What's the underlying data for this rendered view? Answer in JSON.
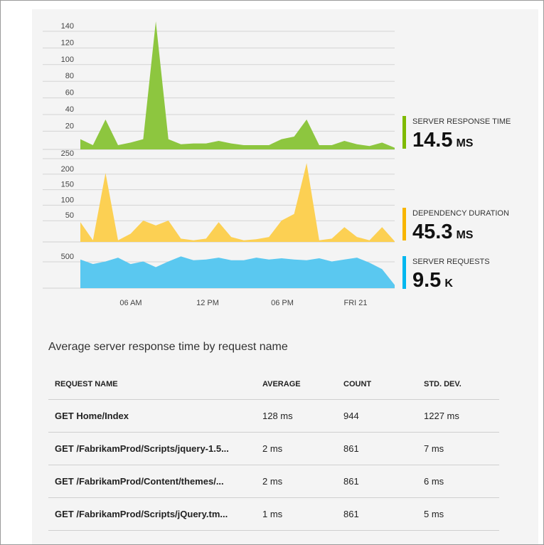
{
  "chart_data": [
    {
      "type": "area",
      "series": [
        {
          "name": "SERVER RESPONSE TIME",
          "values": [
            12,
            5,
            35,
            5,
            8,
            12,
            150,
            12,
            6,
            7,
            7,
            10,
            7,
            5,
            5,
            5,
            12,
            15,
            35,
            5,
            5,
            10,
            6,
            4,
            8,
            2
          ],
          "color": "#8dc63f"
        }
      ],
      "x_ticks": [
        "06 AM",
        "12 PM",
        "06 PM",
        "FRI 21"
      ],
      "y_ticks": [
        "140",
        "120",
        "100",
        "80",
        "60",
        "40",
        "20"
      ],
      "ylim": [
        0,
        150
      ],
      "grid": true
    },
    {
      "type": "area",
      "series": [
        {
          "name": "DEPENDENCY DURATION",
          "values": [
            60,
            5,
            210,
            5,
            25,
            65,
            50,
            65,
            10,
            5,
            10,
            60,
            15,
            5,
            8,
            15,
            65,
            85,
            240,
            5,
            10,
            45,
            15,
            5,
            45,
            2
          ],
          "color": "#fcd053"
        }
      ],
      "y_ticks": [
        "250",
        "200",
        "150",
        "100",
        "50"
      ],
      "ylim": [
        0,
        260
      ],
      "grid": true
    },
    {
      "type": "area",
      "series": [
        {
          "name": "SERVER REQUESTS",
          "values": [
            450,
            380,
            420,
            480,
            380,
            420,
            330,
            420,
            500,
            440,
            450,
            480,
            440,
            440,
            480,
            450,
            470,
            450,
            440,
            470,
            420,
            450,
            480,
            400,
            300,
            50
          ],
          "color": "#5ac8f0"
        }
      ],
      "y_ticks": [
        "500"
      ],
      "ylim": [
        0,
        560
      ],
      "grid": true
    }
  ],
  "metrics": [
    {
      "title": "SERVER RESPONSE TIME",
      "value": "14.5",
      "unit": "MS",
      "color": "#7fba00"
    },
    {
      "title": "DEPENDENCY DURATION",
      "value": "45.3",
      "unit": "MS",
      "color": "#f8b500"
    },
    {
      "title": "SERVER REQUESTS",
      "value": "9.5",
      "unit": "K",
      "color": "#00b7ef"
    }
  ],
  "table": {
    "title": "Average server response time by request name",
    "headers": [
      "REQUEST NAME",
      "AVERAGE",
      "COUNT",
      "STD. DEV."
    ],
    "rows": [
      [
        "GET Home/Index",
        "128 ms",
        "944",
        "1227 ms"
      ],
      [
        "GET /FabrikamProd/Scripts/jquery-1.5...",
        "2 ms",
        "861",
        "7 ms"
      ],
      [
        "GET /FabrikamProd/Content/themes/...",
        "2 ms",
        "861",
        "6 ms"
      ],
      [
        "GET /FabrikamProd/Scripts/jQuery.tm...",
        "1 ms",
        "861",
        "5 ms"
      ]
    ]
  }
}
